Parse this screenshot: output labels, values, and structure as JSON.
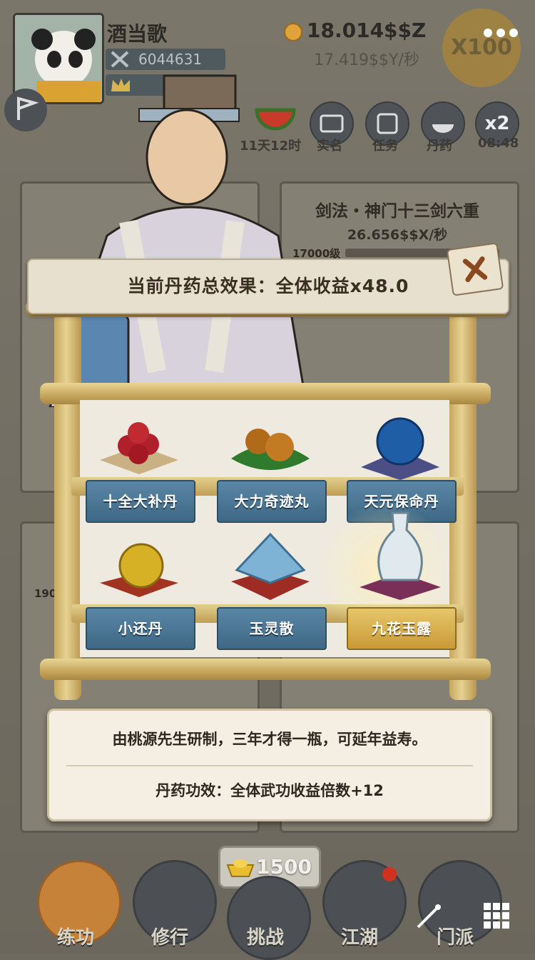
{
  "player": {
    "name": "酒当歌",
    "power": "6044631"
  },
  "currency": {
    "money": "18.014$$Z",
    "rate": "17.419$$Y/秒",
    "multiplier": "X100"
  },
  "top_icons": [
    {
      "label": "11天12时",
      "icon": "watermelon-icon"
    },
    {
      "label": "实名",
      "icon": "id-card-icon"
    },
    {
      "label": "任务",
      "icon": "scroll-icon"
    },
    {
      "label": "丹药",
      "icon": "pill-bowl-icon"
    },
    {
      "label": "08:48",
      "badge": "x2",
      "icon": "speed-icon"
    }
  ],
  "skill_card": {
    "title": "剑法・神门十三剑六重",
    "rate": "26.656$$X/秒",
    "level": "17000级"
  },
  "background_labels": {
    "left_level": "1900"
  },
  "pill_panel": {
    "total_effect": "当前丹药总效果：全体收益x48.0",
    "pills": [
      {
        "name": "十全大补丹",
        "selected": false
      },
      {
        "name": "大力奇迹丸",
        "selected": false
      },
      {
        "name": "天元保命丹",
        "selected": false
      },
      {
        "name": "小还丹",
        "selected": false
      },
      {
        "name": "玉灵散",
        "selected": false
      },
      {
        "name": "九花玉露",
        "selected": true
      }
    ],
    "description": "由桃源先生研制，三年才得一瓶，可延年益寿。",
    "effect": "丹药功效：全体武功收益倍数+12"
  },
  "gold_bar": {
    "amount": "1500"
  },
  "bottom_nav": [
    {
      "label": "练功",
      "active": true
    },
    {
      "label": "修行",
      "active": false
    },
    {
      "label": "挑战",
      "active": false
    },
    {
      "label": "江湖",
      "active": false,
      "badge": true
    },
    {
      "label": "门派",
      "active": false
    }
  ],
  "colors": {
    "accent_gold": "#c99a36",
    "tag_blue": "#3e6884",
    "panel_cream": "#f4efe2"
  }
}
